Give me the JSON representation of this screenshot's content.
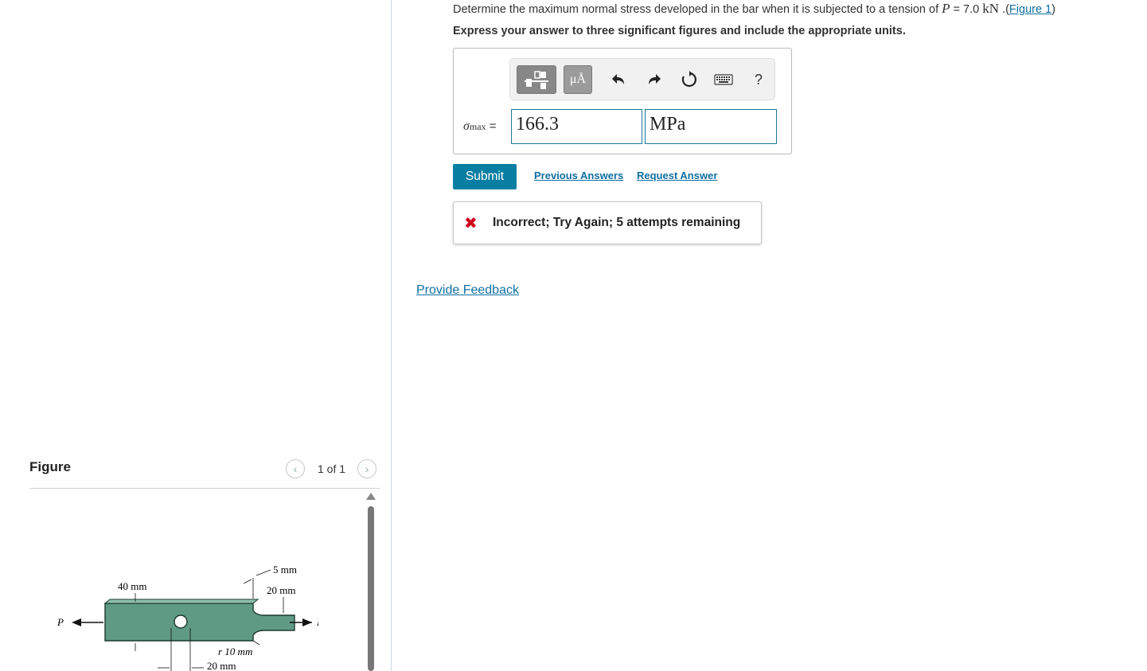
{
  "question": {
    "text": "Determine the maximum normal stress developed in the bar when it is subjected to a tension of ",
    "var": "P",
    "eq": " = 7.0 ",
    "unit": "kN",
    "figure_link": "Figure 1",
    "instruction": "Express your answer to three significant figures and include the appropriate units."
  },
  "answer": {
    "label_symbol": "σ",
    "label_subscript": "max",
    "label_eq": " =",
    "value": "166.3",
    "unit": "MPa"
  },
  "toolbar": {
    "units_label": "μÅ",
    "help_label": "?",
    "icons": [
      "templates-icon",
      "units-icon",
      "undo-icon",
      "redo-icon",
      "reset-icon",
      "keyboard-icon",
      "help-icon"
    ]
  },
  "actions": {
    "submit": "Submit",
    "previous": "Previous Answers",
    "request": "Request Answer"
  },
  "feedback": {
    "mark": "✖",
    "message": "Incorrect; Try Again; 5 attempts remaining"
  },
  "provide_feedback": "Provide Feedback",
  "figure_panel": {
    "title": "Figure",
    "pager": "1 of 1",
    "labels": {
      "load_left": "P",
      "load_right": "P",
      "width_big": "40 mm",
      "step": "5 mm",
      "width_small": "20 mm",
      "radius": "r  10 mm",
      "hole": "20 mm"
    },
    "colors": {
      "bar": "#5f9a85",
      "bar_edge": "#1d3a30"
    }
  },
  "colors": {
    "accent": "#087ea2",
    "link": "#0f6fa1",
    "error": "#d0021b"
  }
}
